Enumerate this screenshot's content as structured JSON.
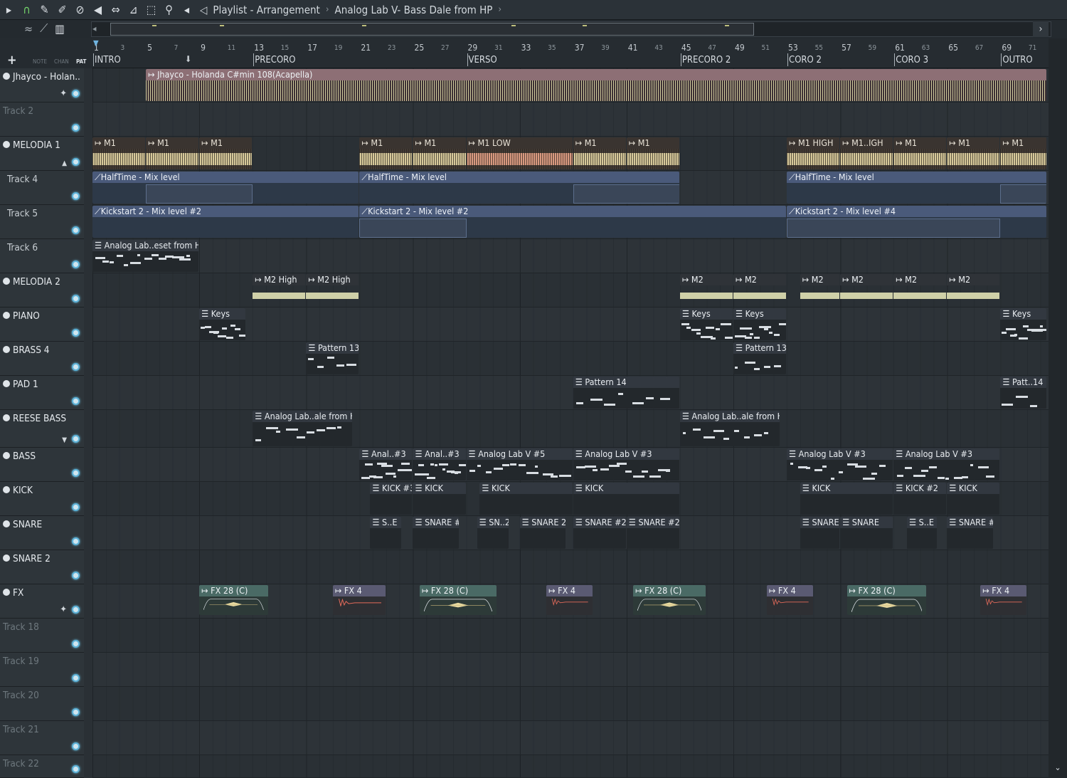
{
  "titlebar": {
    "window": "Playlist - Arrangement",
    "pattern": "Analog Lab V- Bass Dale from HP",
    "sep": "›"
  },
  "left_tabs": {
    "note": "NOTE",
    "chan": "CHAN",
    "pat": "PAT",
    "add": "+"
  },
  "ruler": {
    "bars": [
      "1",
      "3",
      "5",
      "7",
      "9",
      "11",
      "13",
      "15",
      "17",
      "19",
      "21",
      "23",
      "25",
      "27",
      "29",
      "31",
      "33",
      "35",
      "37",
      "39",
      "41",
      "43",
      "45",
      "47",
      "49",
      "51",
      "53",
      "55",
      "57",
      "59",
      "61",
      "63",
      "65",
      "67",
      "69",
      "71"
    ],
    "markers": [
      "INTRO",
      "PRECORO",
      "VERSO",
      "PRECORO 2",
      "CORO 2",
      "CORO 3",
      "OUTRO"
    ]
  },
  "tracks": [
    {
      "name": "Jhayco - Holan..",
      "style": "bright"
    },
    {
      "name": "Track 2",
      "style": "dim"
    },
    {
      "name": "MELODIA 1",
      "style": "bright"
    },
    {
      "name": "Track 4",
      "style": "mid"
    },
    {
      "name": "Track 5",
      "style": "mid"
    },
    {
      "name": "Track 6",
      "style": "mid"
    },
    {
      "name": "MELODIA 2",
      "style": "bright"
    },
    {
      "name": "PIANO",
      "style": "bright"
    },
    {
      "name": "BRASS 4",
      "style": "bright"
    },
    {
      "name": "PAD 1",
      "style": "bright"
    },
    {
      "name": "REESE BASS",
      "style": "bright"
    },
    {
      "name": "BASS",
      "style": "bright"
    },
    {
      "name": "KICK",
      "style": "bright"
    },
    {
      "name": "SNARE",
      "style": "bright"
    },
    {
      "name": "SNARE 2",
      "style": "bright"
    },
    {
      "name": "FX",
      "style": "bright"
    },
    {
      "name": "Track 18",
      "style": "dim"
    },
    {
      "name": "Track 19",
      "style": "dim"
    },
    {
      "name": "Track 20",
      "style": "dim"
    },
    {
      "name": "Track 21",
      "style": "dim"
    },
    {
      "name": "Track 22",
      "style": "dim"
    }
  ],
  "clips": {
    "acapella": "Jhayco - Holanda C#min 108(Acapella)",
    "m1": "M1",
    "m1_low": "M1 LOW",
    "m1_high": "M1 HIGH",
    "m1_igh": "M1..IGH",
    "halftime": "HalfTime - Mix level",
    "kickstart2": "Kickstart 2 - Mix level #2",
    "kickstart4": "Kickstart 2 - Mix level #4",
    "analog_preset": "Analog Lab..eset from HP",
    "m2_high": "M2 High",
    "m2": "M2",
    "keys": "Keys",
    "pattern13": "Pattern 13",
    "pattern14": "Pattern 14",
    "patt14": "Patt..14",
    "analog_dale": "Analog Lab..ale from HP",
    "anal3": "Anal..#3",
    "alv5": "Analog Lab V #5",
    "alv3": "Analog Lab V #3",
    "kick3": "KICK #3",
    "kick": "KICK",
    "kick2": "KICK #2",
    "se": "S..E",
    "snare2": "SNARE #2",
    "sn2": "SN..2",
    "snare_2": "SNARE 2",
    "snare": "SNARE",
    "fx28": "FX 28 (C)",
    "fx4": "FX 4"
  },
  "colors": {
    "accent": "#73d46a",
    "automation": "#4a5a7a",
    "audio_clip": "#8d6f75",
    "knob": "#5db3d9"
  }
}
